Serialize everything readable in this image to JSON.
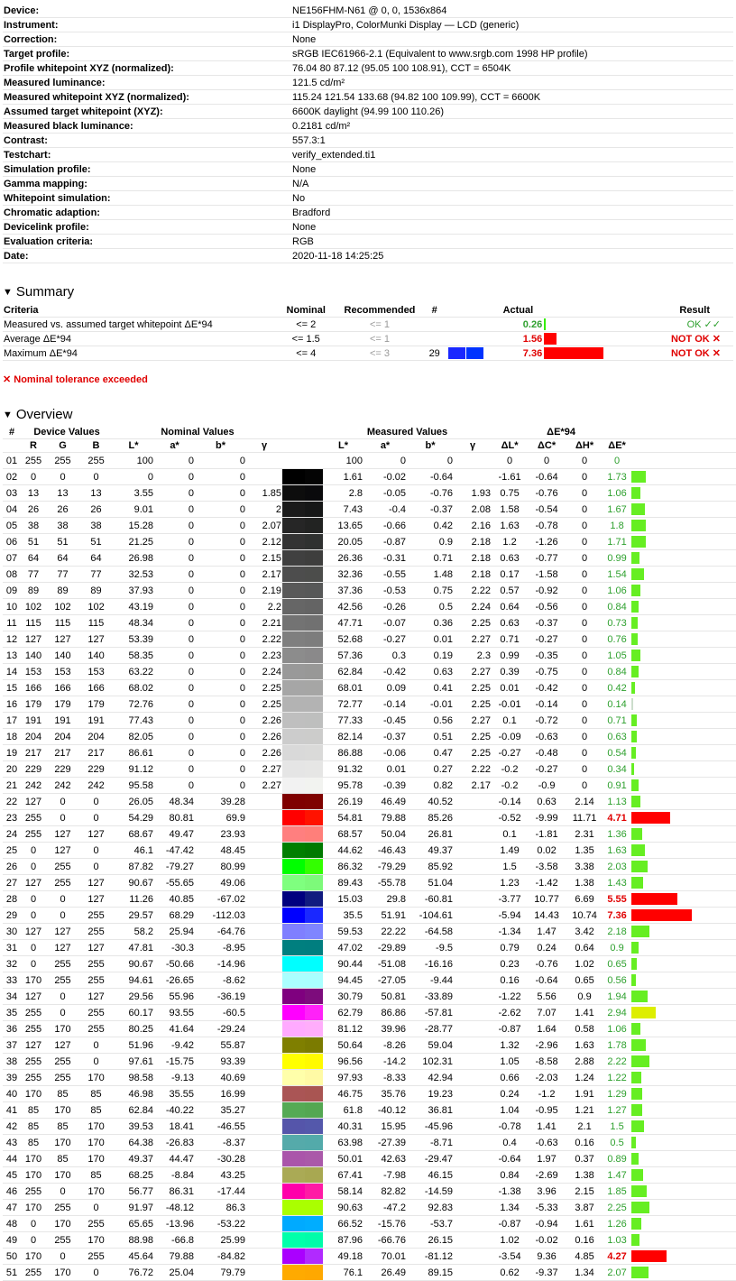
{
  "info": [
    [
      "Device:",
      "NE156FHM-N61 @ 0, 0, 1536x864"
    ],
    [
      "Instrument:",
      "i1 DisplayPro, ColorMunki Display — LCD (generic)"
    ],
    [
      "Correction:",
      "None"
    ],
    [
      "Target profile:",
      "sRGB IEC61966-2.1 (Equivalent to www.srgb.com 1998 HP profile)"
    ],
    [
      "Profile whitepoint XYZ (normalized):",
      "76.04 80 87.12 (95.05 100 108.91), CCT = 6504K"
    ],
    [
      "Measured luminance:",
      "121.5 cd/m²"
    ],
    [
      "Measured whitepoint XYZ (normalized):",
      "115.24 121.54 133.68 (94.82 100 109.99), CCT = 6600K"
    ],
    [
      "Assumed target whitepoint (XYZ):",
      "6600K daylight (94.99 100 110.26)"
    ],
    [
      "Measured black luminance:",
      "0.2181 cd/m²"
    ],
    [
      "Contrast:",
      "557.3:1"
    ],
    [
      "Testchart:",
      "verify_extended.ti1"
    ],
    [
      "Simulation profile:",
      "None"
    ],
    [
      "Gamma mapping:",
      "N/A"
    ],
    [
      "Whitepoint simulation:",
      "No"
    ],
    [
      "Chromatic adaption:",
      "Bradford"
    ],
    [
      "Devicelink profile:",
      "None"
    ],
    [
      "Evaluation criteria:",
      "RGB"
    ],
    [
      "Date:",
      "2020-11-18 14:25:25"
    ]
  ],
  "summary": {
    "title": "Summary",
    "headers": {
      "criteria": "Criteria",
      "nominal": "Nominal",
      "recommended": "Recommended",
      "num": "#",
      "actual": "Actual",
      "result": "Result"
    },
    "rows": [
      {
        "criteria": "Measured vs. assumed target whitepoint ΔE*94",
        "nominal": "<= 2",
        "recommended": "<= 1",
        "num": "",
        "actual": "0.26",
        "bar": 0.26,
        "ok": true,
        "result": "OK ✓✓"
      },
      {
        "criteria": "Average ΔE*94",
        "nominal": "<= 1.5",
        "recommended": "<= 1",
        "num": "",
        "actual": "1.56",
        "bar": 1.56,
        "ok": false,
        "result": "NOT OK ✕"
      },
      {
        "criteria": "Maximum ΔE*94",
        "nominal": "<= 4",
        "recommended": "<= 3",
        "num": "29",
        "actual": "7.36",
        "bar": 7.36,
        "ok": false,
        "result": "NOT OK ✕",
        "swatch": [
          "#1a28ff",
          "#0033ff"
        ]
      }
    ],
    "warning": "✕ Nominal tolerance exceeded"
  },
  "overview": {
    "title": "Overview",
    "group_headers": {
      "num": "#",
      "device": "Device Values",
      "nominal": "Nominal Values",
      "measured": "Measured Values",
      "de": "ΔE*94"
    },
    "col_headers": [
      "R",
      "G",
      "B",
      "L*",
      "a*",
      "b*",
      "γ",
      "L*",
      "a*",
      "b*",
      "γ",
      "ΔL*",
      "ΔC*",
      "ΔH*",
      "ΔE*"
    ],
    "rows": [
      [
        "01",
        "255",
        "255",
        "255",
        "100",
        "0",
        "0",
        "",
        "100",
        "0",
        "0",
        "",
        "0",
        "0",
        "0",
        "0",
        "#ffffff",
        "#ffffff"
      ],
      [
        "02",
        "0",
        "0",
        "0",
        "0",
        "0",
        "0",
        "",
        "1.61",
        "-0.02",
        "-0.64",
        "",
        "-1.61",
        "-0.64",
        "0",
        "1.73",
        "#000000",
        "#040404"
      ],
      [
        "03",
        "13",
        "13",
        "13",
        "3.55",
        "0",
        "0",
        "1.85",
        "2.8",
        "-0.05",
        "-0.76",
        "1.93",
        "0.75",
        "-0.76",
        "0",
        "1.06",
        "#0d0d0d",
        "#0a0a0c"
      ],
      [
        "04",
        "26",
        "26",
        "26",
        "9.01",
        "0",
        "0",
        "2",
        "7.43",
        "-0.4",
        "-0.37",
        "2.08",
        "1.58",
        "-0.54",
        "0",
        "1.67",
        "#1a1a1a",
        "#161717"
      ],
      [
        "05",
        "38",
        "38",
        "38",
        "15.28",
        "0",
        "0",
        "2.07",
        "13.65",
        "-0.66",
        "0.42",
        "2.16",
        "1.63",
        "-0.78",
        "0",
        "1.8",
        "#262626",
        "#222322"
      ],
      [
        "06",
        "51",
        "51",
        "51",
        "21.25",
        "0",
        "0",
        "2.12",
        "20.05",
        "-0.87",
        "0.9",
        "2.18",
        "1.2",
        "-1.26",
        "0",
        "1.71",
        "#333333",
        "#2f3130"
      ],
      [
        "07",
        "64",
        "64",
        "64",
        "26.98",
        "0",
        "0",
        "2.15",
        "26.36",
        "-0.31",
        "0.71",
        "2.18",
        "0.63",
        "-0.77",
        "0",
        "0.99",
        "#404040",
        "#3e3e3d"
      ],
      [
        "08",
        "77",
        "77",
        "77",
        "32.53",
        "0",
        "0",
        "2.17",
        "32.36",
        "-0.55",
        "1.48",
        "2.18",
        "0.17",
        "-1.58",
        "0",
        "1.54",
        "#4d4d4d",
        "#4c4d4b"
      ],
      [
        "09",
        "89",
        "89",
        "89",
        "37.93",
        "0",
        "0",
        "2.19",
        "37.36",
        "-0.53",
        "0.75",
        "2.22",
        "0.57",
        "-0.92",
        "0",
        "1.06",
        "#595959",
        "#575858"
      ],
      [
        "10",
        "102",
        "102",
        "102",
        "43.19",
        "0",
        "0",
        "2.2",
        "42.56",
        "-0.26",
        "0.5",
        "2.24",
        "0.64",
        "-0.56",
        "0",
        "0.84",
        "#666666",
        "#646464"
      ],
      [
        "11",
        "115",
        "115",
        "115",
        "48.34",
        "0",
        "0",
        "2.21",
        "47.71",
        "-0.07",
        "0.36",
        "2.25",
        "0.63",
        "-0.37",
        "0",
        "0.73",
        "#737373",
        "#717171"
      ],
      [
        "12",
        "127",
        "127",
        "127",
        "53.39",
        "0",
        "0",
        "2.22",
        "52.68",
        "-0.27",
        "0.01",
        "2.27",
        "0.71",
        "-0.27",
        "0",
        "0.76",
        "#7f7f7f",
        "#7d7d7d"
      ],
      [
        "13",
        "140",
        "140",
        "140",
        "58.35",
        "0",
        "0",
        "2.23",
        "57.36",
        "0.3",
        "0.19",
        "2.3",
        "0.99",
        "-0.35",
        "0",
        "1.05",
        "#8c8c8c",
        "#8a898a"
      ],
      [
        "14",
        "153",
        "153",
        "153",
        "63.22",
        "0",
        "0",
        "2.24",
        "62.84",
        "-0.42",
        "0.63",
        "2.27",
        "0.39",
        "-0.75",
        "0",
        "0.84",
        "#999999",
        "#989897"
      ],
      [
        "15",
        "166",
        "166",
        "166",
        "68.02",
        "0",
        "0",
        "2.25",
        "68.01",
        "0.09",
        "0.41",
        "2.25",
        "0.01",
        "-0.42",
        "0",
        "0.42",
        "#a6a6a6",
        "#a6a6a5"
      ],
      [
        "16",
        "179",
        "179",
        "179",
        "72.76",
        "0",
        "0",
        "2.25",
        "72.77",
        "-0.14",
        "-0.01",
        "2.25",
        "-0.01",
        "-0.14",
        "0",
        "0.14",
        "#b3b3b3",
        "#b3b3b3"
      ],
      [
        "17",
        "191",
        "191",
        "191",
        "77.43",
        "0",
        "0",
        "2.26",
        "77.33",
        "-0.45",
        "0.56",
        "2.27",
        "0.1",
        "-0.72",
        "0",
        "0.71",
        "#bfbfbf",
        "#bebfbe"
      ],
      [
        "18",
        "204",
        "204",
        "204",
        "82.05",
        "0",
        "0",
        "2.26",
        "82.14",
        "-0.37",
        "0.51",
        "2.25",
        "-0.09",
        "-0.63",
        "0",
        "0.63",
        "#cccccc",
        "#cccccb"
      ],
      [
        "19",
        "217",
        "217",
        "217",
        "86.61",
        "0",
        "0",
        "2.26",
        "86.88",
        "-0.06",
        "0.47",
        "2.25",
        "-0.27",
        "-0.48",
        "0",
        "0.54",
        "#d9d9d9",
        "#dadad9"
      ],
      [
        "20",
        "229",
        "229",
        "229",
        "91.12",
        "0",
        "0",
        "2.27",
        "91.32",
        "0.01",
        "0.27",
        "2.22",
        "-0.2",
        "-0.27",
        "0",
        "0.34",
        "#e5e5e5",
        "#e6e6e5"
      ],
      [
        "21",
        "242",
        "242",
        "242",
        "95.58",
        "0",
        "0",
        "2.27",
        "95.78",
        "-0.39",
        "0.82",
        "2.17",
        "-0.2",
        "-0.9",
        "0",
        "0.91",
        "#f2f2f2",
        "#f2f3f0"
      ],
      [
        "22",
        "127",
        "0",
        "0",
        "26.05",
        "48.34",
        "39.28",
        "",
        "26.19",
        "46.49",
        "40.52",
        "",
        "-0.14",
        "0.63",
        "2.14",
        "1.13",
        "#7f0000",
        "#7f0200"
      ],
      [
        "23",
        "255",
        "0",
        "0",
        "54.29",
        "80.81",
        "69.9",
        "",
        "54.81",
        "79.88",
        "85.26",
        "",
        "-0.52",
        "-9.99",
        "11.71",
        "4.71",
        "#ff0000",
        "#ff1200"
      ],
      [
        "24",
        "255",
        "127",
        "127",
        "68.67",
        "49.47",
        "23.93",
        "",
        "68.57",
        "50.04",
        "26.81",
        "",
        "0.1",
        "-1.81",
        "2.31",
        "1.36",
        "#ff7f7f",
        "#ff7f7a"
      ],
      [
        "25",
        "0",
        "127",
        "0",
        "46.1",
        "-47.42",
        "48.45",
        "",
        "44.62",
        "-46.43",
        "49.37",
        "",
        "1.49",
        "0.02",
        "1.35",
        "1.63",
        "#007f00",
        "#007a00"
      ],
      [
        "26",
        "0",
        "255",
        "0",
        "87.82",
        "-79.27",
        "80.99",
        "",
        "86.32",
        "-79.29",
        "85.92",
        "",
        "1.5",
        "-3.58",
        "3.38",
        "2.03",
        "#00ff00",
        "#33ff00"
      ],
      [
        "27",
        "127",
        "255",
        "127",
        "90.67",
        "-55.65",
        "49.06",
        "",
        "89.43",
        "-55.78",
        "51.04",
        "",
        "1.23",
        "-1.42",
        "1.38",
        "1.43",
        "#7fff7f",
        "#7dfa7a"
      ],
      [
        "28",
        "0",
        "0",
        "127",
        "11.26",
        "40.85",
        "-67.02",
        "",
        "15.03",
        "29.8",
        "-60.81",
        "",
        "-3.77",
        "10.77",
        "6.69",
        "5.55",
        "#00007f",
        "#111b7f"
      ],
      [
        "29",
        "0",
        "0",
        "255",
        "29.57",
        "68.29",
        "-112.03",
        "",
        "35.5",
        "51.91",
        "-104.61",
        "",
        "-5.94",
        "14.43",
        "10.74",
        "7.36",
        "#0000ff",
        "#1a28ff"
      ],
      [
        "30",
        "127",
        "127",
        "255",
        "58.2",
        "25.94",
        "-64.76",
        "",
        "59.53",
        "22.22",
        "-64.58",
        "",
        "-1.34",
        "1.47",
        "3.42",
        "2.18",
        "#7f7fff",
        "#7f85ff"
      ],
      [
        "31",
        "0",
        "127",
        "127",
        "47.81",
        "-30.3",
        "-8.95",
        "",
        "47.02",
        "-29.89",
        "-9.5",
        "",
        "0.79",
        "0.24",
        "0.64",
        "0.9",
        "#007f7f",
        "#007e7f"
      ],
      [
        "32",
        "0",
        "255",
        "255",
        "90.67",
        "-50.66",
        "-14.96",
        "",
        "90.44",
        "-51.08",
        "-16.16",
        "",
        "0.23",
        "-0.76",
        "1.02",
        "0.65",
        "#00ffff",
        "#00ffff"
      ],
      [
        "33",
        "170",
        "255",
        "255",
        "94.61",
        "-26.65",
        "-8.62",
        "",
        "94.45",
        "-27.05",
        "-9.44",
        "",
        "0.16",
        "-0.64",
        "0.65",
        "0.56",
        "#aaffff",
        "#a9ffff"
      ],
      [
        "34",
        "127",
        "0",
        "127",
        "29.56",
        "55.96",
        "-36.19",
        "",
        "30.79",
        "50.81",
        "-33.89",
        "",
        "-1.22",
        "5.56",
        "0.9",
        "1.94",
        "#7f007f",
        "#7d0c7c"
      ],
      [
        "35",
        "255",
        "0",
        "255",
        "60.17",
        "93.55",
        "-60.5",
        "",
        "62.79",
        "86.86",
        "-57.81",
        "",
        "-2.62",
        "7.07",
        "1.41",
        "2.94",
        "#ff00ff",
        "#ff22f8"
      ],
      [
        "36",
        "255",
        "170",
        "255",
        "80.25",
        "41.64",
        "-29.24",
        "",
        "81.12",
        "39.96",
        "-28.77",
        "",
        "-0.87",
        "1.64",
        "0.58",
        "1.06",
        "#ffaaff",
        "#ffadfb"
      ],
      [
        "37",
        "127",
        "127",
        "0",
        "51.96",
        "-9.42",
        "55.87",
        "",
        "50.64",
        "-8.26",
        "59.04",
        "",
        "1.32",
        "-2.96",
        "1.63",
        "1.78",
        "#7f7f00",
        "#7b7b00"
      ],
      [
        "38",
        "255",
        "255",
        "0",
        "97.61",
        "-15.75",
        "93.39",
        "",
        "96.56",
        "-14.2",
        "102.31",
        "",
        "1.05",
        "-8.58",
        "2.88",
        "2.22",
        "#ffff00",
        "#fffa00"
      ],
      [
        "39",
        "255",
        "255",
        "170",
        "98.58",
        "-9.13",
        "40.69",
        "",
        "97.93",
        "-8.33",
        "42.94",
        "",
        "0.66",
        "-2.03",
        "1.24",
        "1.22",
        "#ffffaa",
        "#fffaa5"
      ],
      [
        "40",
        "170",
        "85",
        "85",
        "46.98",
        "35.55",
        "16.99",
        "",
        "46.75",
        "35.76",
        "19.23",
        "",
        "0.24",
        "-1.2",
        "1.91",
        "1.29",
        "#aa5555",
        "#a95552"
      ],
      [
        "41",
        "85",
        "170",
        "85",
        "62.84",
        "-40.22",
        "35.27",
        "",
        "61.8",
        "-40.12",
        "36.81",
        "",
        "1.04",
        "-0.95",
        "1.21",
        "1.27",
        "#55aa55",
        "#54a752"
      ],
      [
        "42",
        "85",
        "85",
        "170",
        "39.53",
        "18.41",
        "-46.55",
        "",
        "40.31",
        "15.95",
        "-45.96",
        "",
        "-0.78",
        "1.41",
        "2.1",
        "1.5",
        "#5555aa",
        "#5458ab"
      ],
      [
        "43",
        "85",
        "170",
        "170",
        "64.38",
        "-26.83",
        "-8.37",
        "",
        "63.98",
        "-27.39",
        "-8.71",
        "",
        "0.4",
        "-0.63",
        "0.16",
        "0.5",
        "#55aaaa",
        "#53aaaa"
      ],
      [
        "44",
        "170",
        "85",
        "170",
        "49.37",
        "44.47",
        "-30.28",
        "",
        "50.01",
        "42.63",
        "-29.47",
        "",
        "-0.64",
        "1.97",
        "0.37",
        "0.89",
        "#aa55aa",
        "#aa59a9"
      ],
      [
        "45",
        "170",
        "170",
        "85",
        "68.25",
        "-8.84",
        "43.25",
        "",
        "67.41",
        "-7.98",
        "46.15",
        "",
        "0.84",
        "-2.69",
        "1.38",
        "1.47",
        "#aaaa55",
        "#a8a851"
      ],
      [
        "46",
        "255",
        "0",
        "170",
        "56.77",
        "86.31",
        "-17.44",
        "",
        "58.14",
        "82.82",
        "-14.59",
        "",
        "-1.38",
        "3.96",
        "2.15",
        "1.85",
        "#ff00aa",
        "#ff1aa5"
      ],
      [
        "47",
        "170",
        "255",
        "0",
        "91.97",
        "-48.12",
        "86.3",
        "",
        "90.63",
        "-47.2",
        "92.83",
        "",
        "1.34",
        "-5.33",
        "3.87",
        "2.25",
        "#aaff00",
        "#aaff00"
      ],
      [
        "48",
        "0",
        "170",
        "255",
        "65.65",
        "-13.96",
        "-53.22",
        "",
        "66.52",
        "-15.76",
        "-53.7",
        "",
        "-0.87",
        "-0.94",
        "1.61",
        "1.26",
        "#00aaff",
        "#00adff"
      ],
      [
        "49",
        "0",
        "255",
        "170",
        "88.98",
        "-66.8",
        "25.99",
        "",
        "87.96",
        "-66.76",
        "26.15",
        "",
        "1.02",
        "-0.02",
        "0.16",
        "1.03",
        "#00ffaa",
        "#00fca9"
      ],
      [
        "50",
        "170",
        "0",
        "255",
        "45.64",
        "79.88",
        "-84.82",
        "",
        "49.18",
        "70.01",
        "-81.12",
        "",
        "-3.54",
        "9.36",
        "4.85",
        "4.27",
        "#aa00ff",
        "#b12aff"
      ],
      [
        "51",
        "255",
        "170",
        "0",
        "76.72",
        "25.04",
        "79.79",
        "",
        "76.1",
        "26.49",
        "89.15",
        "",
        "0.62",
        "-9.37",
        "1.34",
        "2.07",
        "#ffaa00",
        "#ffa800"
      ]
    ]
  }
}
